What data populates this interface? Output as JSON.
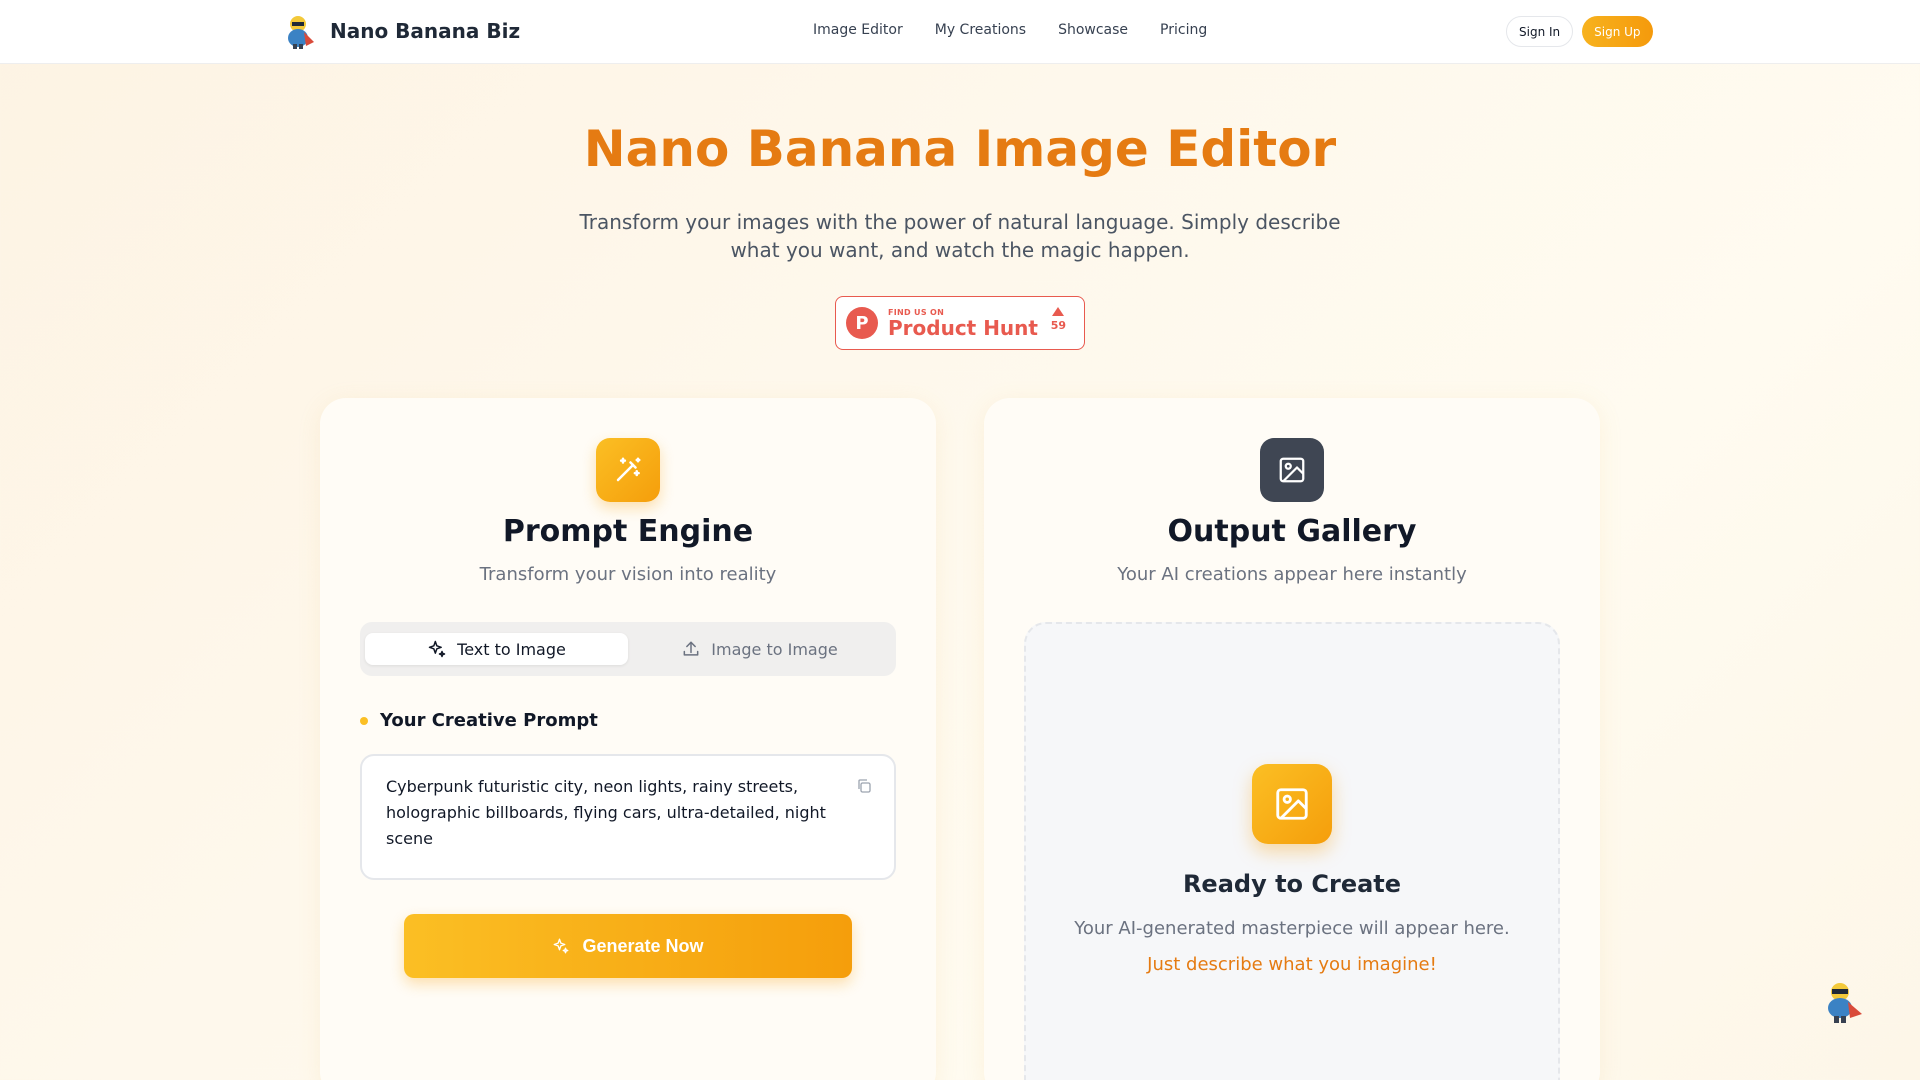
{
  "header": {
    "brand": "Nano Banana Biz",
    "nav": [
      "Image Editor",
      "My Creations",
      "Showcase",
      "Pricing"
    ],
    "sign_in": "Sign In",
    "sign_up": "Sign Up"
  },
  "hero": {
    "title": "Nano Banana Image Editor",
    "subtitle": "Transform your images with the power of natural language. Simply describe what you want, and watch the magic happen.",
    "badge": {
      "find_us": "FIND US ON",
      "name": "Product Hunt",
      "votes": "59"
    }
  },
  "prompt_engine": {
    "title": "Prompt Engine",
    "subtitle": "Transform your vision into reality",
    "tabs": [
      {
        "label": "Text to Image",
        "active": true
      },
      {
        "label": "Image to Image",
        "active": false
      }
    ],
    "prompt_label": "Your Creative Prompt",
    "prompt_value": "Cyberpunk futuristic city, neon lights, rainy streets, holographic billboards, flying cars, ultra-detailed, night scene",
    "generate_button": "Generate Now"
  },
  "output_gallery": {
    "title": "Output Gallery",
    "subtitle": "Your AI creations appear here instantly",
    "empty_title": "Ready to Create",
    "empty_sub": "Your AI-generated masterpiece will appear here.",
    "empty_cta": "Just describe what you imagine!"
  },
  "colors": {
    "accent": "#e57b12",
    "button": "#f59e0b",
    "product_hunt": "#e85a4f"
  }
}
